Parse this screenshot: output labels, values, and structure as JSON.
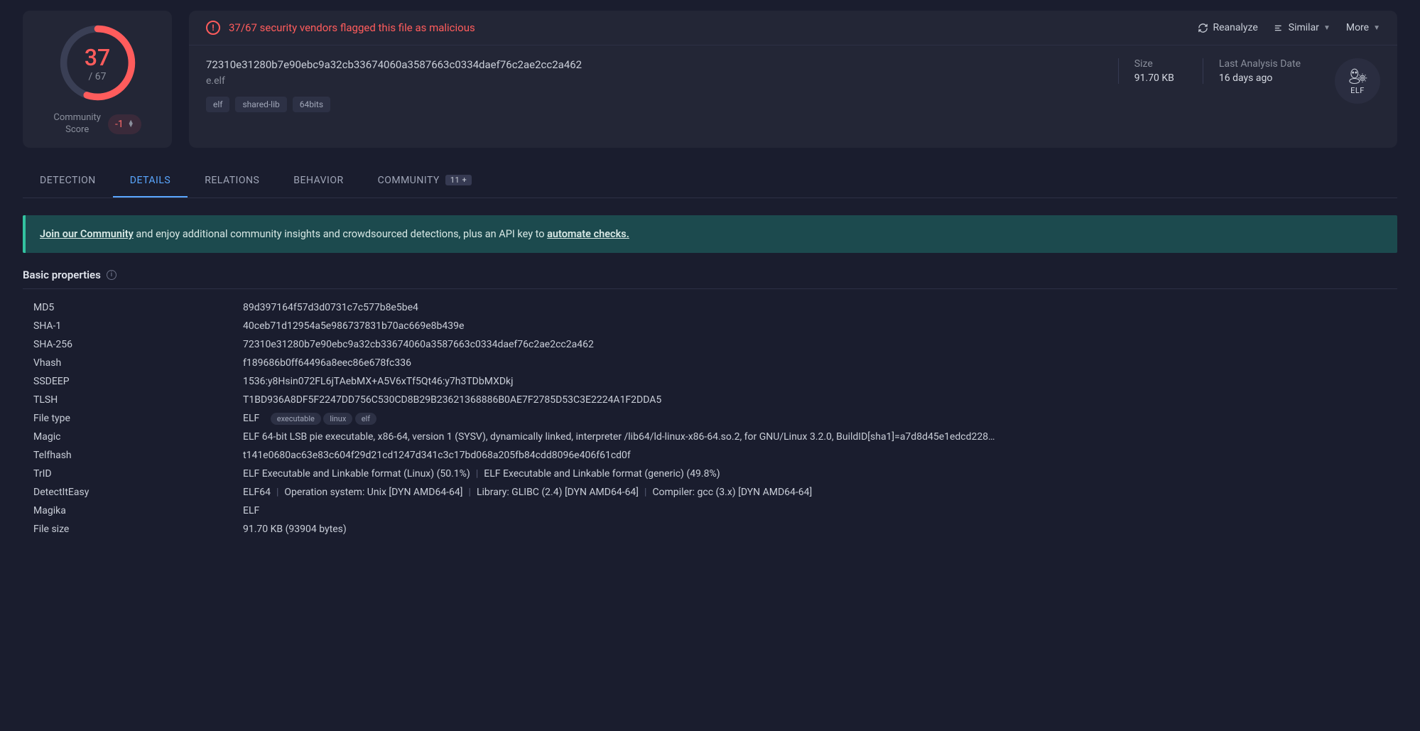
{
  "score": {
    "detections": "37",
    "total": "/ 67",
    "community_label": "Community Score",
    "community_value": "-1"
  },
  "flag": {
    "text": "37/67 security vendors flagged this file as malicious"
  },
  "actions": {
    "reanalyze": "Reanalyze",
    "similar": "Similar",
    "more": "More"
  },
  "sample": {
    "hash": "72310e31280b7e90ebc9a32cb33674060a3587663c0334daef76c2ae2cc2a462",
    "filename": "e.elf",
    "tags": [
      "elf",
      "shared-lib",
      "64bits"
    ]
  },
  "size": {
    "label": "Size",
    "value": "91.70 KB"
  },
  "analysis": {
    "label": "Last Analysis Date",
    "value": "16 days ago"
  },
  "elf_badge": "ELF",
  "tabs": [
    {
      "label": "DETECTION"
    },
    {
      "label": "DETAILS"
    },
    {
      "label": "RELATIONS"
    },
    {
      "label": "BEHAVIOR"
    },
    {
      "label": "COMMUNITY",
      "count": "11 +"
    }
  ],
  "banner": {
    "link1": "Join our Community",
    "mid": " and enjoy additional community insights and crowdsourced detections, plus an API key to ",
    "link2": "automate checks."
  },
  "section_title": "Basic properties",
  "props": {
    "md5": {
      "k": "MD5",
      "v": "89d397164f57d3d0731c7c577b8e5be4"
    },
    "sha1": {
      "k": "SHA-1",
      "v": "40ceb71d12954a5e986737831b70ac669e8b439e"
    },
    "sha256": {
      "k": "SHA-256",
      "v": "72310e31280b7e90ebc9a32cb33674060a3587663c0334daef76c2ae2cc2a462"
    },
    "vhash": {
      "k": "Vhash",
      "v": "f189686b0ff64496a8eec86e678fc336"
    },
    "ssdeep": {
      "k": "SSDEEP",
      "v": "1536:y8Hsin072FL6jTAebMX+A5V6xTf5Qt46:y7h3TDbMXDkj"
    },
    "tlsh": {
      "k": "TLSH",
      "v": "T1BD936A8DF5F2247DD756C530CD8B29B23621368886B0AE7F2785D53C3E2224A1F2DDA5"
    },
    "filetype": {
      "k": "File type",
      "v": "ELF",
      "tags": [
        "executable",
        "linux",
        "elf"
      ]
    },
    "magic": {
      "k": "Magic",
      "v": "ELF 64-bit LSB pie executable, x86-64, version 1 (SYSV), dynamically linked, interpreter /lib64/ld-linux-x86-64.so.2, for GNU/Linux 3.2.0, BuildID[sha1]=a7d8d45e1edcd228…"
    },
    "telfhash": {
      "k": "Telfhash",
      "v": "t141e0680ac63e83c604f29d21cd1247d341c3c17bd068a205fb84cdd8096e406f61cd0f"
    },
    "trid": {
      "k": "TrID",
      "parts": [
        "ELF Executable and Linkable format (Linux) (50.1%)",
        "ELF Executable and Linkable format (generic) (49.8%)"
      ]
    },
    "die": {
      "k": "DetectItEasy",
      "parts": [
        "ELF64",
        "Operation system: Unix [DYN AMD64-64]",
        "Library: GLIBC (2.4) [DYN AMD64-64]",
        "Compiler: gcc (3.x) [DYN AMD64-64]"
      ]
    },
    "magika": {
      "k": "Magika",
      "v": "ELF"
    },
    "filesize": {
      "k": "File size",
      "v": "91.70 KB (93904 bytes)"
    }
  }
}
